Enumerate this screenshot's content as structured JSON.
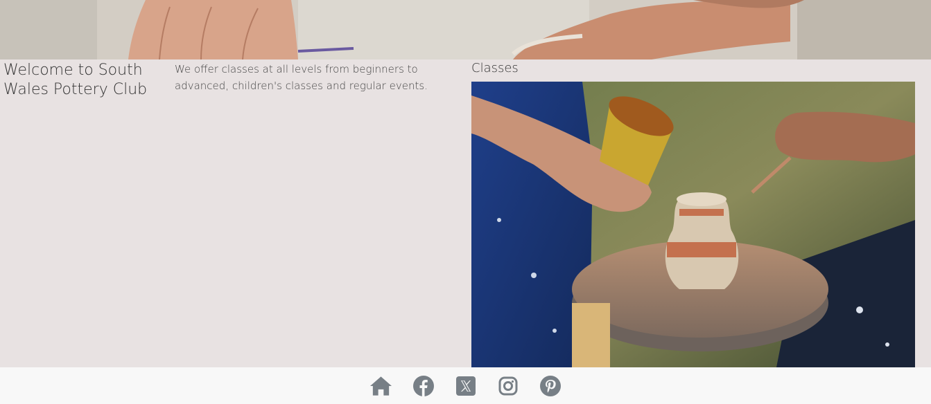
{
  "hero": {
    "image": "pottery-hands-hero-image"
  },
  "main": {
    "welcome_heading": "Welcome to South Wales Pottery Club",
    "intro_text": "We offer classes at all levels from beginners to advanced, children's classes and regular events.",
    "classes_heading": "Classes",
    "classes_image": "pottery-wheel-class-photo"
  },
  "footer": {
    "icons": [
      "home-icon",
      "facebook-icon",
      "x-twitter-icon",
      "instagram-icon",
      "pinterest-icon"
    ],
    "icon_color": "#777f86"
  },
  "colors": {
    "page_background": "#e8e2e2",
    "footer_background": "#f8f8f8"
  }
}
